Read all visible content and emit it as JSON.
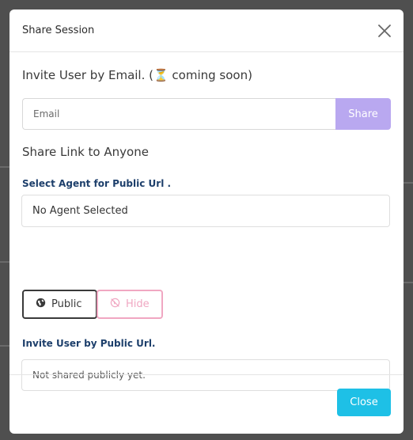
{
  "modal": {
    "title": "Share Session",
    "invite_email_heading": "Invite User by Email. (⏳ coming soon)",
    "email_placeholder": "Email",
    "share_label": "Share",
    "share_link_heading": "Share Link to Anyone",
    "select_agent_label": "Select Agent for Public Url .",
    "agent_selected": "No Agent Selected",
    "visibility": {
      "public_label": "Public",
      "hide_label": "Hide",
      "selected": "Public"
    },
    "invite_url_label": "Invite User by Public Url.",
    "public_url_value": "Not shared publicly yet.",
    "close_label": "Close"
  },
  "colors": {
    "share_button": "#b9a8f0",
    "close_button": "#1ec0e6",
    "hide_accent": "#f0a7c2",
    "label_navy": "#1d3f6b"
  },
  "icons": {
    "close": "close-icon",
    "public": "globe-icon",
    "hide": "globe-off-icon"
  }
}
